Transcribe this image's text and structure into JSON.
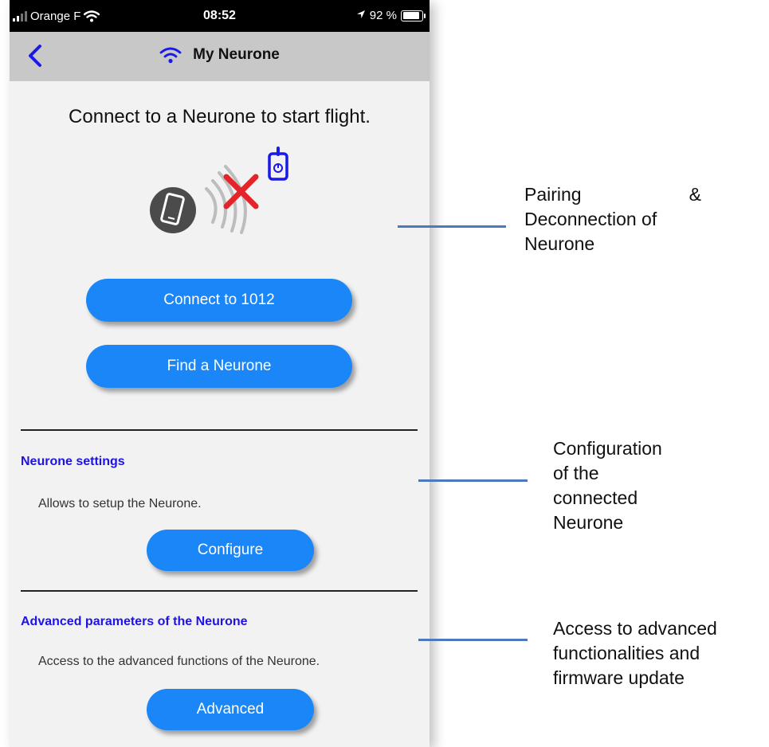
{
  "status_bar": {
    "carrier": "Orange F",
    "time": "08:52",
    "battery_text": "92 %",
    "battery_level": 0.92
  },
  "nav": {
    "title": "My Neurone",
    "accent_color": "#1a1ae6"
  },
  "main": {
    "headline": "Connect to a Neurone to start flight.",
    "connect_button": "Connect to 1012",
    "find_button": "Find a Neurone"
  },
  "settings": {
    "title": "Neurone settings",
    "description": "Allows to setup the Neurone.",
    "button": "Configure"
  },
  "advanced": {
    "title": "Advanced parameters of the Neurone",
    "description": "Access to the advanced functions of the Neurone.",
    "button": "Advanced"
  },
  "annotations": {
    "pairing": {
      "line1_left": "Pairing",
      "line1_right": "&",
      "line2": "Deconnection of",
      "line3": "Neurone"
    },
    "configuration": {
      "line1": "Configuration",
      "line2": "of the",
      "line3": "connected",
      "line4": "Neurone"
    },
    "access": {
      "line1": "Access to advanced",
      "line2": "functionalities and",
      "line3": "firmware update"
    }
  },
  "colors": {
    "button": "#1a86f7",
    "section_title": "#1d12e8",
    "leader_line": "#4e78bd",
    "navbar": "#c8c8c8"
  }
}
